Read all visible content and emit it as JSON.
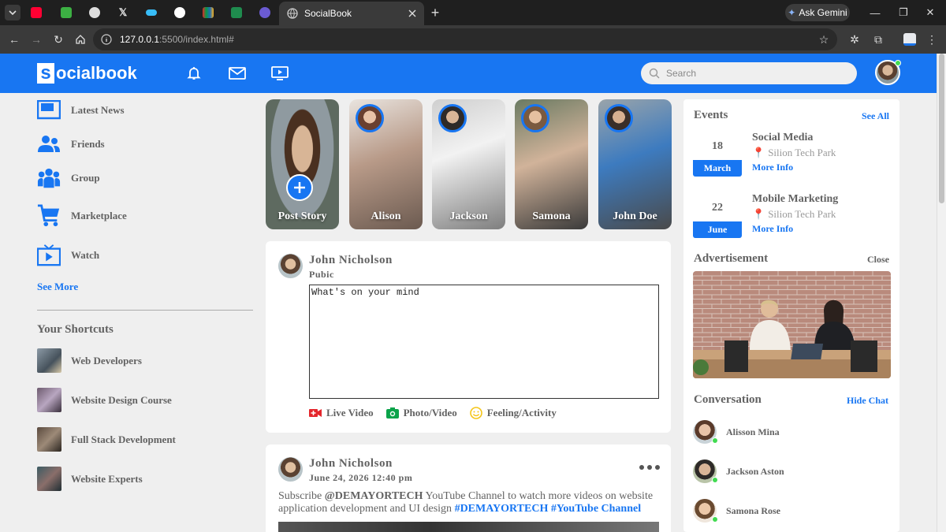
{
  "browser": {
    "active_tab_title": "SocialBook",
    "url_host": "127.0.0.1",
    "url_rest": ":5500/index.html#",
    "ask_gemini": "Ask Gemini"
  },
  "navbar": {
    "logo_letter": "s",
    "logo_rest": "ocialbook",
    "search_placeholder": "Search"
  },
  "left": {
    "items": [
      {
        "label": "Latest News",
        "icon": "news-icon"
      },
      {
        "label": "Friends",
        "icon": "friends-icon"
      },
      {
        "label": "Group",
        "icon": "group-icon"
      },
      {
        "label": "Marketplace",
        "icon": "cart-icon"
      },
      {
        "label": "Watch",
        "icon": "watch-icon"
      }
    ],
    "see_more": "See More",
    "shortcuts_title": "Your Shortcuts",
    "shortcuts": [
      {
        "label": "Web Developers"
      },
      {
        "label": "Website Design Course"
      },
      {
        "label": "Full Stack Development"
      },
      {
        "label": "Website Experts"
      }
    ]
  },
  "stories": [
    {
      "name": "Post Story"
    },
    {
      "name": "Alison"
    },
    {
      "name": "Jackson"
    },
    {
      "name": "Samona"
    },
    {
      "name": "John Doe"
    }
  ],
  "composer": {
    "user_name": "John Nicholson",
    "visibility": "Pubic",
    "placeholder": "What's on your mind",
    "links": [
      "Live Video",
      "Photo/Video",
      "Feeling/Activity"
    ]
  },
  "post": {
    "user_name": "John Nicholson",
    "date": "June 24, 2026 12:40 pm",
    "text_before": "Subscribe ",
    "handle": "@DEMAYORTECH",
    "text_middle": " YouTube Channel to watch more videos on website application development and UI design ",
    "tag1": "#DEMAYORTECH",
    "tag2": "#YouTube Channel"
  },
  "right": {
    "events_title": "Events",
    "see_all": "See All",
    "events": [
      {
        "day": "18",
        "month": "March",
        "title": "Social Media",
        "location": "Silion Tech Park",
        "more": "More Info"
      },
      {
        "day": "22",
        "month": "June",
        "title": "Mobile Marketing",
        "location": "Silion Tech Park",
        "more": "More Info"
      }
    ],
    "ad_title": "Advertisement",
    "ad_close": "Close",
    "convo_title": "Conversation",
    "hide_chat": "Hide Chat",
    "conversations": [
      {
        "name": "Alisson Mina"
      },
      {
        "name": "Jackson Aston"
      },
      {
        "name": "Samona Rose"
      }
    ]
  },
  "colors": {
    "brand": "#1876f2",
    "online": "#41db51",
    "text": "#626262"
  }
}
